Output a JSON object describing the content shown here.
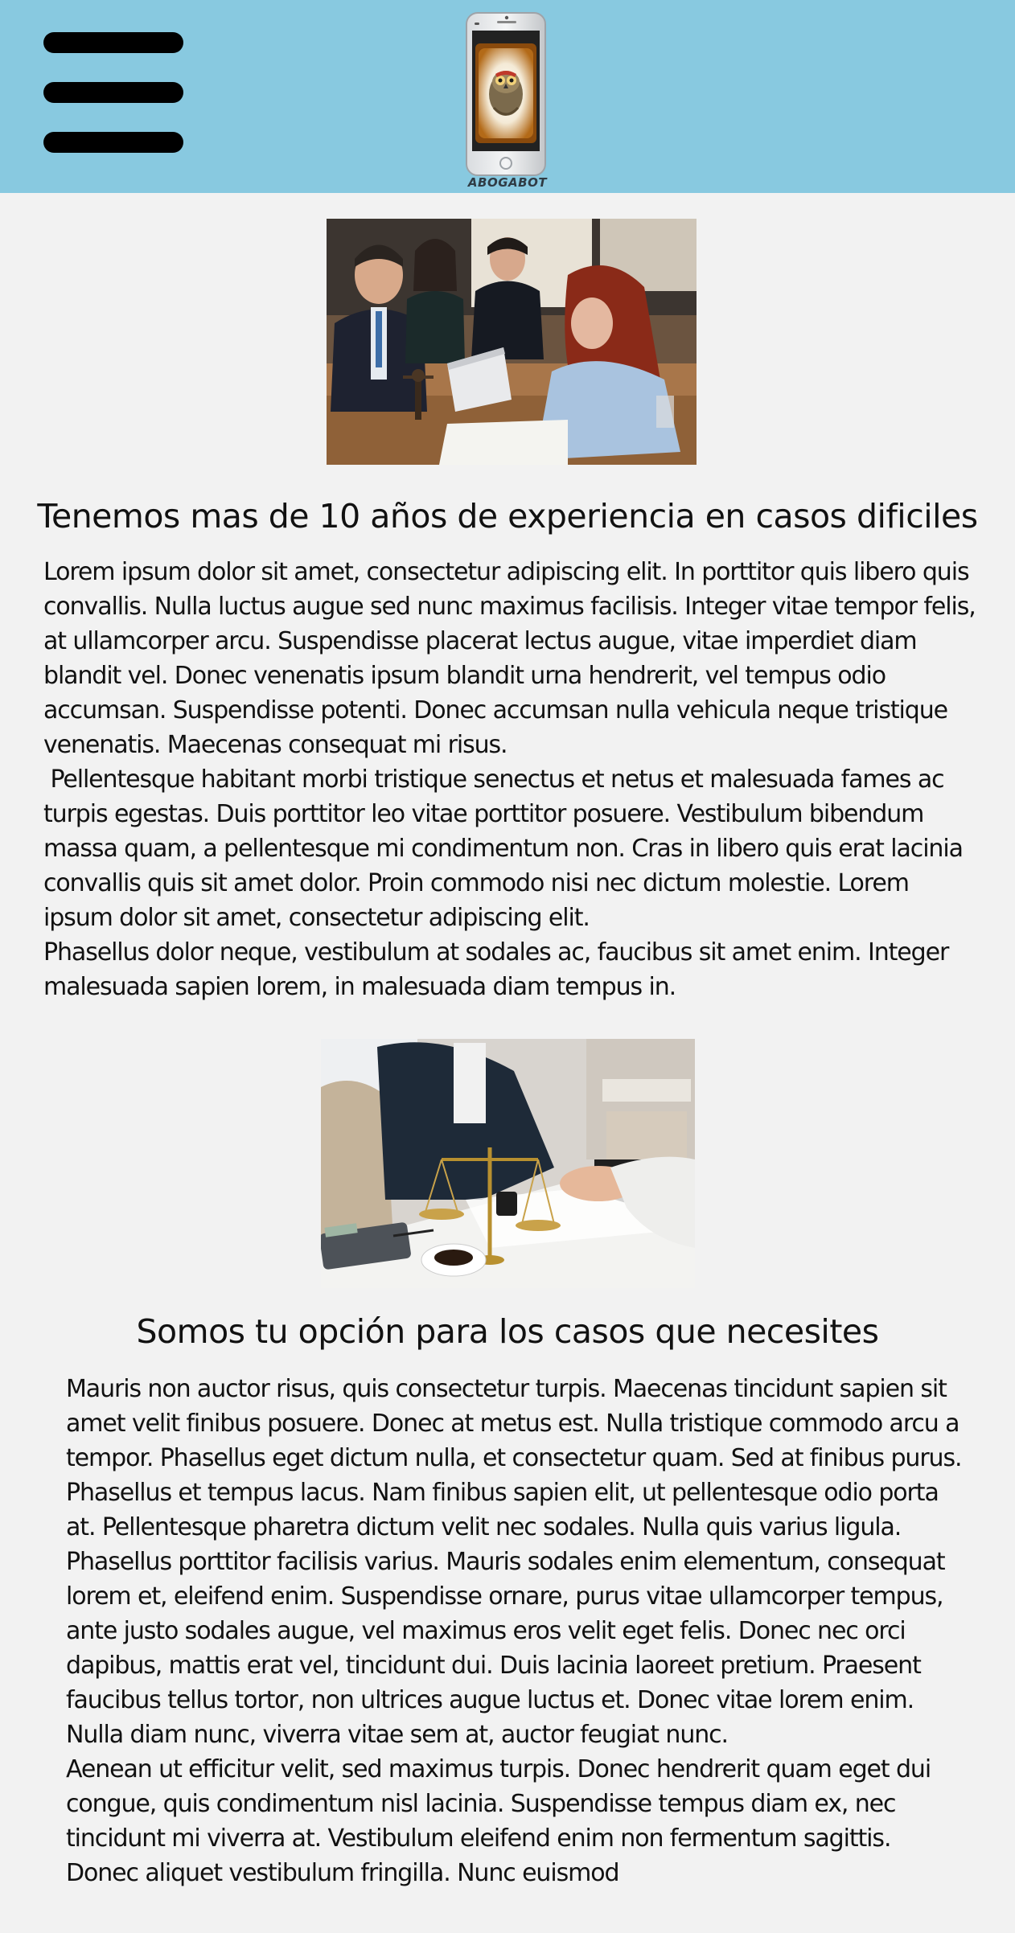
{
  "header": {
    "menu_icon": "hamburger-menu-icon",
    "logo_icon": "phone-owl-logo-icon",
    "logo_text": "ABOGABOT",
    "background_color": "#88c9e0"
  },
  "section1": {
    "image_description_icon": "lawyers-meeting-photo",
    "heading": "Tenemos mas de 10 años de experiencia en casos dificiles",
    "paragraphs": [
      "Lorem ipsum dolor sit amet, consectetur adipiscing elit. In porttitor quis libero quis convallis. Nulla luctus augue sed nunc maximus facilisis. Integer vitae tempor felis, at ullamcorper arcu. Suspendisse placerat lectus augue, vitae imperdiet diam blandit vel. Donec venenatis ipsum blandit urna hendrerit, vel tempus odio accumsan. Suspendisse potenti. Donec accumsan nulla vehicula neque tristique venenatis. Maecenas consequat mi risus.",
      " Pellentesque habitant morbi tristique senectus et netus et malesuada fames ac turpis egestas. Duis porttitor leo vitae porttitor posuere. Vestibulum bibendum massa quam, a pellentesque mi condimentum non. Cras in libero quis erat lacinia convallis quis sit amet dolor. Proin commodo nisi nec dictum molestie. Lorem ipsum dolor sit amet, consectetur adipiscing elit.",
      "Phasellus dolor neque, vestibulum at sodales ac, faucibus sit amet enim. Integer malesuada sapien lorem, in malesuada diam tempus in."
    ]
  },
  "section2": {
    "image_description_icon": "handshake-scales-photo",
    "heading": "Somos tu opción para los casos que necesites",
    "paragraphs": [
      "Mauris non auctor risus, quis consectetur turpis. Maecenas tincidunt sapien sit amet velit finibus posuere. Donec at metus est. Nulla tristique commodo arcu a tempor. Phasellus eget dictum nulla, et consectetur quam. Sed at finibus purus. Phasellus et tempus lacus. Nam finibus sapien elit, ut pellentesque odio porta at. Pellentesque pharetra dictum velit nec sodales. Nulla quis varius ligula. Phasellus porttitor facilisis varius. Mauris sodales enim elementum, consequat lorem et, eleifend enim. Suspendisse ornare, purus vitae ullamcorper tempus, ante justo sodales augue, vel maximus eros velit eget felis. Donec nec orci dapibus, mattis erat vel, tincidunt dui. Duis lacinia laoreet pretium. Praesent faucibus tellus tortor, non ultrices augue luctus et. Donec vitae lorem enim. Nulla diam nunc, viverra vitae sem at, auctor feugiat nunc.",
      "Aenean ut efficitur velit, sed maximus turpis. Donec hendrerit quam eget dui congue, quis condimentum nisl lacinia. Suspendisse tempus diam ex, nec tincidunt mi viverra at. Vestibulum eleifend enim non fermentum sagittis. Donec aliquet vestibulum fringilla. Nunc euismod"
    ]
  }
}
